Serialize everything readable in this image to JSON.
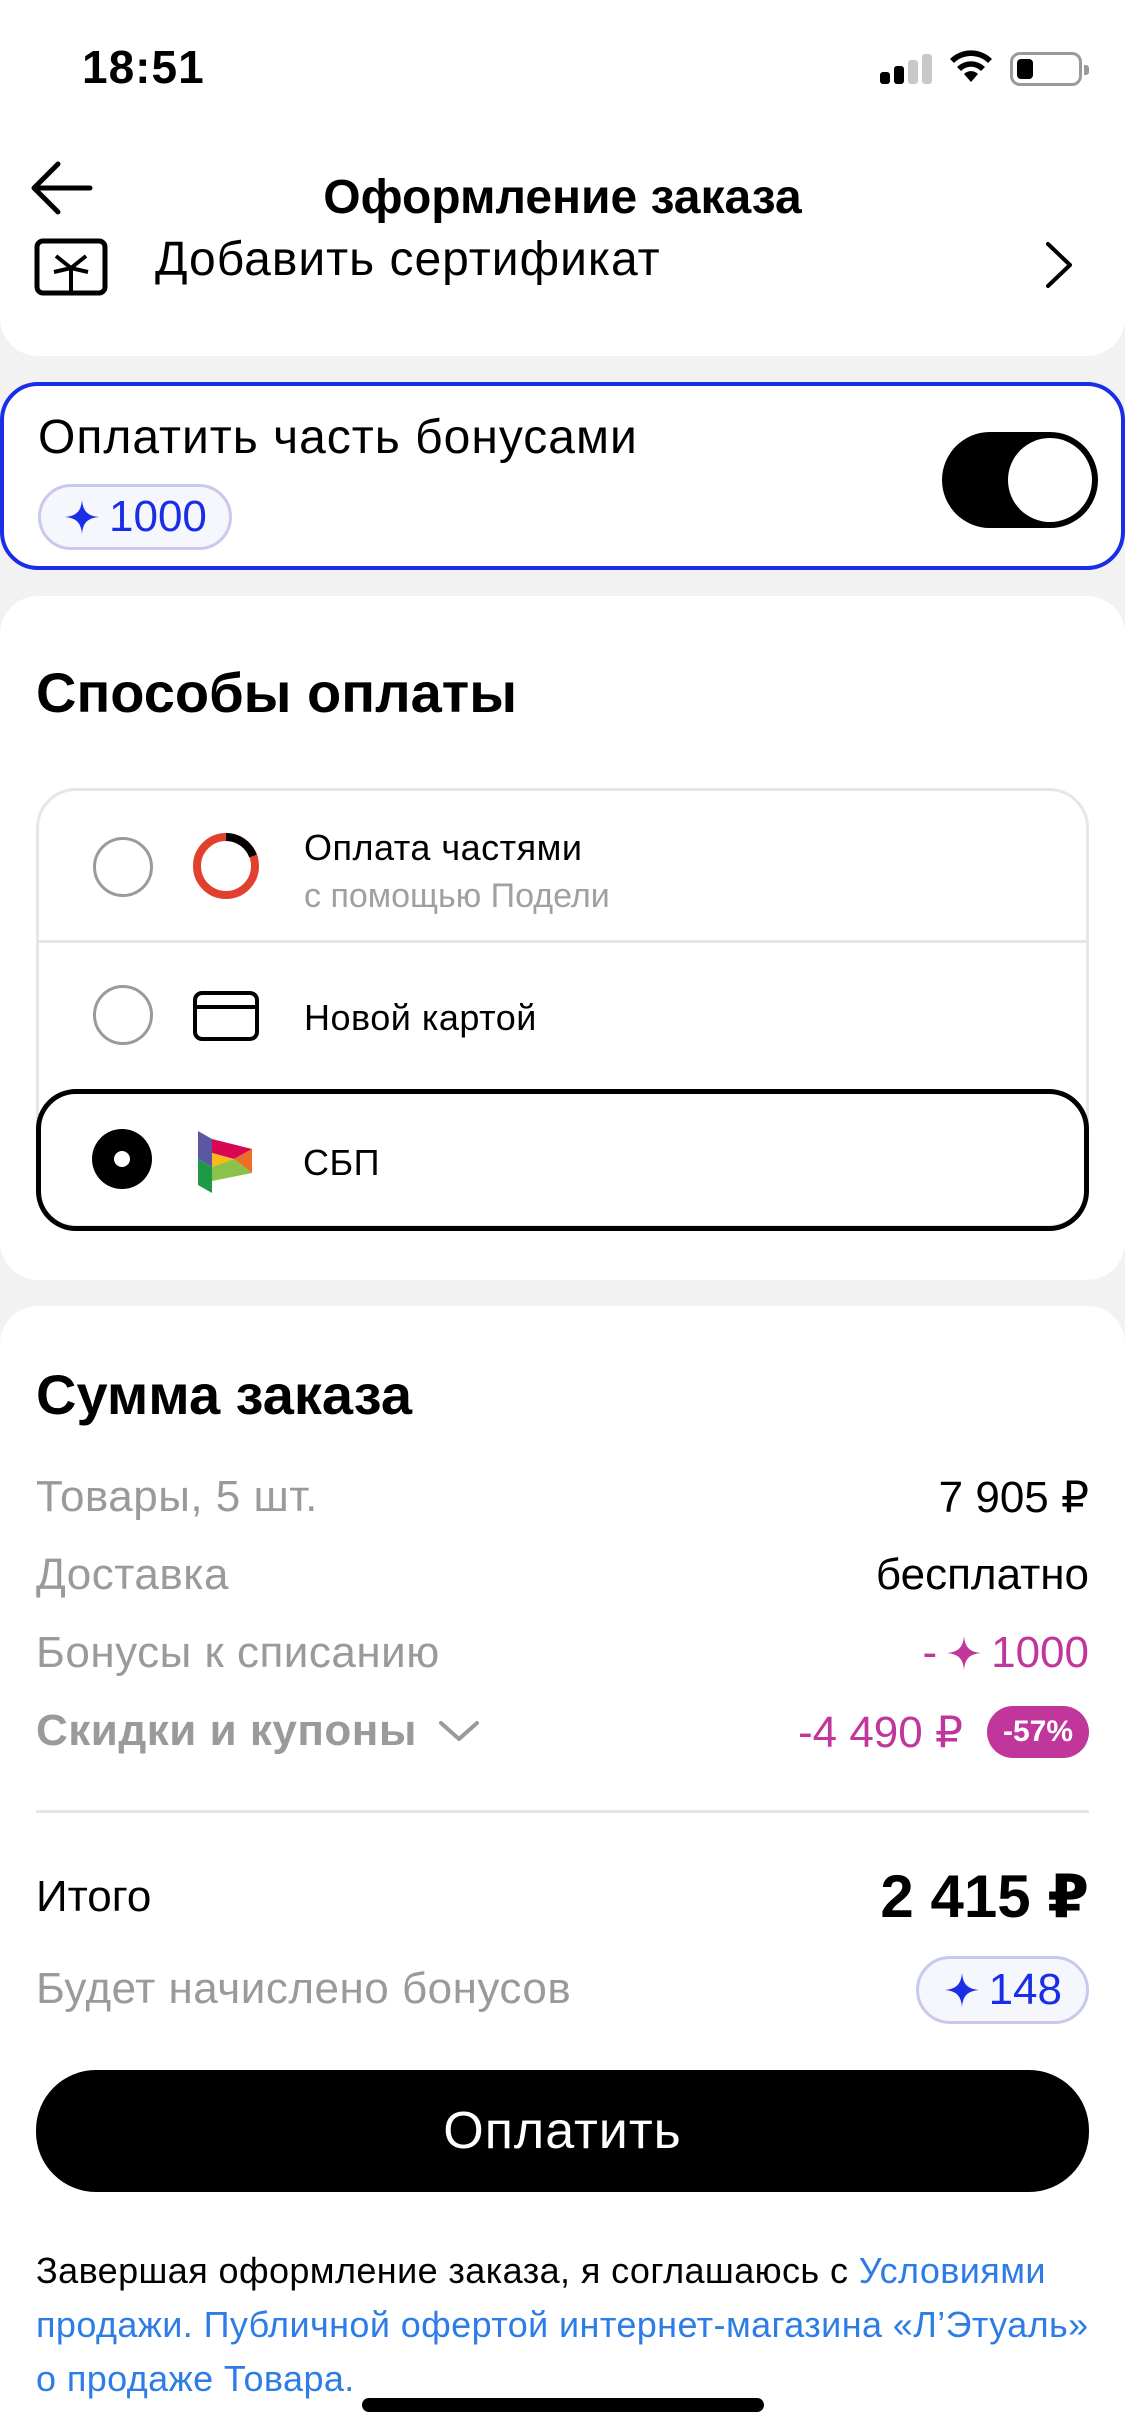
{
  "status_bar": {
    "time": "18:51"
  },
  "header": {
    "title": "Оформление заказа"
  },
  "certificate": {
    "label": "Добавить сертификат"
  },
  "bonus": {
    "title": "Оплатить часть бонусами",
    "chip_value": "1000"
  },
  "payment": {
    "heading": "Способы оплаты",
    "options": [
      {
        "title": "Оплата частями",
        "subtitle": "с помощью Подели",
        "selected": false
      },
      {
        "title": "Новой картой",
        "selected": false
      },
      {
        "title": "СБП",
        "selected": true
      }
    ]
  },
  "summary": {
    "heading": "Сумма заказа",
    "items_label": "Товары, 5 шт.",
    "items_value": "7 905 ₽",
    "delivery_label": "Доставка",
    "delivery_value": "бесплатно",
    "bonus_label": "Бонусы к списанию",
    "bonus_prefix": "-",
    "bonus_value": "1000",
    "discount_label": "Скидки и купоны",
    "discount_value": "-4 490 ₽",
    "discount_badge": "-57%",
    "total_label": "Итого",
    "total_value": "2 415 ₽",
    "earn_label": "Будет начислено бонусов",
    "earn_value": "148",
    "pay_button": "Оплатить"
  },
  "legal": {
    "text": "Завершая оформление заказа, я соглашаюсь с ",
    "link": "Условиями продажи. Публичной офертой интернет-магазина «Л’Этуаль» о продаже Товара."
  },
  "colors": {
    "accent_blue": "#1a2ee8",
    "accent_pink": "#c0369b",
    "link_blue": "#2e7ce6"
  },
  "icons": [
    "back-arrow-icon",
    "certificate-icon",
    "chevron-right-icon",
    "star-icon",
    "podeli-logo-icon",
    "card-icon",
    "sbp-logo-icon",
    "chevron-down-icon"
  ]
}
